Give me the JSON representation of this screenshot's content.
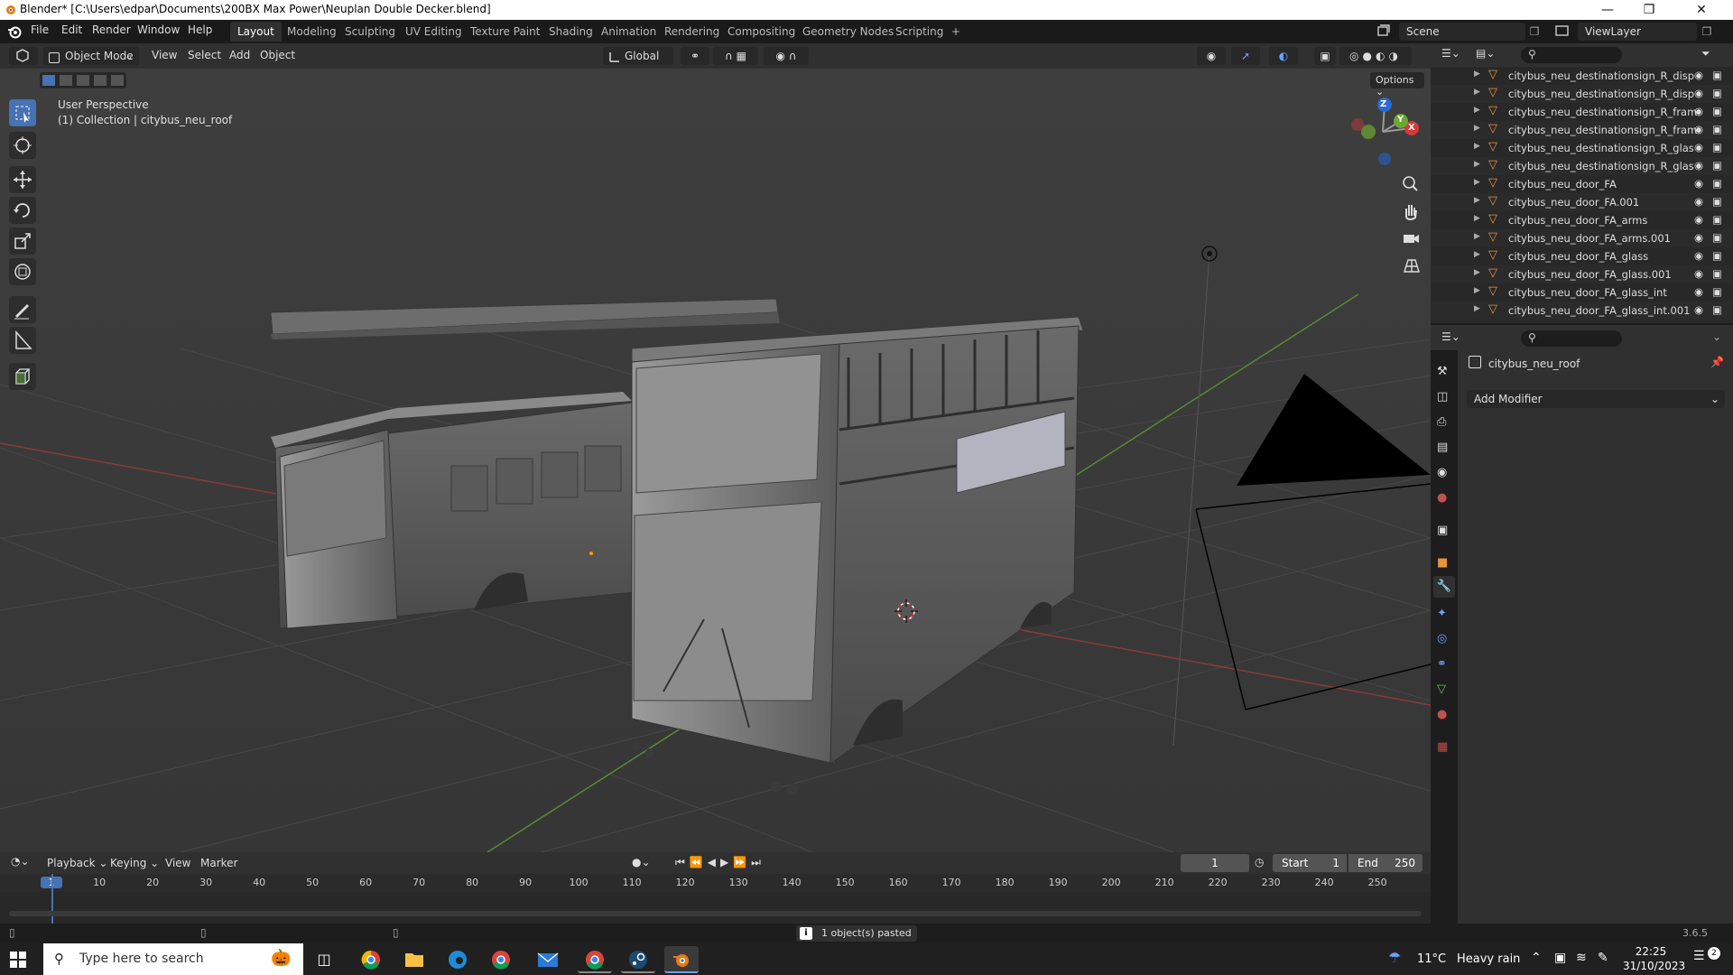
{
  "window": {
    "title": "Blender* [C:\\Users\\edpar\\Documents\\200BX Max Power\\Neuplan Double Decker.blend]"
  },
  "menu": [
    "File",
    "Edit",
    "Render",
    "Window",
    "Help"
  ],
  "workspaces": [
    "Layout",
    "Modeling",
    "Sculpting",
    "UV Editing",
    "Texture Paint",
    "Shading",
    "Animation",
    "Rendering",
    "Compositing",
    "Geometry Nodes",
    "Scripting",
    "+"
  ],
  "scene": {
    "label": "Scene",
    "viewlayer": "ViewLayer"
  },
  "header": {
    "mode": "Object Mode",
    "view": "View",
    "select": "Select",
    "add": "Add",
    "object": "Object",
    "orientation": "Global",
    "options": "Options"
  },
  "viewport": {
    "perspective": "User Perspective",
    "collection": "(1) Collection | citybus_neu_roof",
    "gizmo": {
      "z": "Z",
      "y": "Y",
      "x": "X"
    }
  },
  "outliner": {
    "items": [
      "citybus_neu_destinationsign_R_disp",
      "citybus_neu_destinationsign_R_disp",
      "citybus_neu_destinationsign_R_fram",
      "citybus_neu_destinationsign_R_fram",
      "citybus_neu_destinationsign_R_glas",
      "citybus_neu_destinationsign_R_glas",
      "citybus_neu_door_FA",
      "citybus_neu_door_FA.001",
      "citybus_neu_door_FA_arms",
      "citybus_neu_door_FA_arms.001",
      "citybus_neu_door_FA_glass",
      "citybus_neu_door_FA_glass.001",
      "citybus_neu_door_FA_glass_int",
      "citybus_neu_door_FA_glass_int.001"
    ]
  },
  "properties": {
    "object_name": "citybus_neu_roof",
    "add_modifier": "Add Modifier"
  },
  "timeline": {
    "playback": "Playback",
    "keying": "Keying",
    "view": "View",
    "marker": "Marker",
    "current_frame": "1",
    "start_label": "Start",
    "start": "1",
    "end_label": "End",
    "end": "250",
    "ticks": [
      "1",
      "10",
      "20",
      "30",
      "40",
      "50",
      "60",
      "70",
      "80",
      "90",
      "100",
      "110",
      "120",
      "130",
      "140",
      "150",
      "160",
      "170",
      "180",
      "190",
      "200",
      "210",
      "220",
      "230",
      "240",
      "250"
    ]
  },
  "status": {
    "message": "1 object(s) pasted",
    "version": "3.6.5"
  },
  "taskbar": {
    "search_placeholder": "Type here to search",
    "weather_temp": "11°C",
    "weather_desc": "Heavy rain",
    "time": "22:25",
    "date": "31/10/2023",
    "notifications": "2"
  }
}
